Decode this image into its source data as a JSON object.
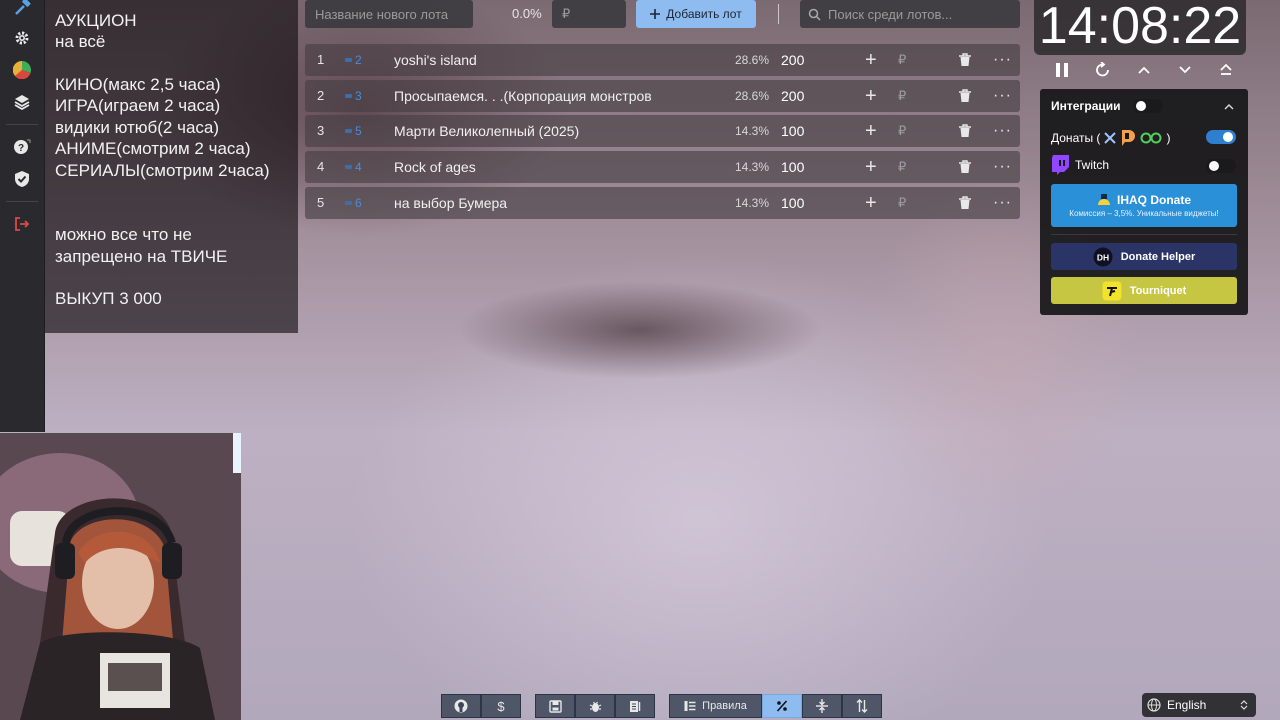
{
  "notes": {
    "lines": [
      "АУКЦИОН",
      "на всё",
      "",
      "КИНО(макс 2,5 часа)",
      "ИГРА(играем 2 часа)",
      "видики ютюб(2 часа)",
      "АНИМЕ(смотрим 2 часа)",
      "СЕРИАЛЫ(смотрим 2часа)",
      "",
      "",
      "можно все что не",
      "запрещено на ТВИЧЕ",
      "",
      "ВЫКУП 3 000"
    ]
  },
  "sidebar": {
    "items": [
      {
        "icon": "hammer-icon"
      },
      {
        "icon": "gear-icon"
      },
      {
        "icon": "pie-chart-icon"
      },
      {
        "icon": "layers-icon"
      },
      {
        "icon": "help-icon"
      },
      {
        "icon": "shield-icon"
      },
      {
        "icon": "logout-icon"
      }
    ]
  },
  "topbar": {
    "new_lot_placeholder": "Название нового лота",
    "percent": "0.0%",
    "currency": "₽",
    "add_label": "Добавить лот",
    "search_placeholder": "Поиск среди лотов..."
  },
  "lots": [
    {
      "index": "1",
      "order": "2",
      "name": "yoshi's island",
      "percent": "28.6%",
      "amount": "200",
      "currency": "₽"
    },
    {
      "index": "2",
      "order": "3",
      "name": "Просыпаемся. . .(Корпорация монстров",
      "percent": "28.6%",
      "amount": "200",
      "currency": "₽"
    },
    {
      "index": "3",
      "order": "5",
      "name": "Марти Великолепный (2025)",
      "percent": "14.3%",
      "amount": "100",
      "currency": "₽"
    },
    {
      "index": "4",
      "order": "4",
      "name": "Rock of ages",
      "percent": "14.3%",
      "amount": "100",
      "currency": "₽"
    },
    {
      "index": "5",
      "order": "6",
      "name": "на выбор Бумера",
      "percent": "14.3%",
      "amount": "100",
      "currency": "₽"
    }
  ],
  "timer": {
    "time": "14:08:22"
  },
  "integrations": {
    "title": "Интеграции",
    "donations_label": "Донаты (",
    "donations_close": ")",
    "twitch_label": "Twitch",
    "ihaq_title": "IHAQ Donate",
    "ihaq_sub": "Комиссия – 3,5%. Уникальные виджеты!",
    "donate_helper": "Donate Helper",
    "tourniquet": "Tourniquet",
    "colors": {
      "ihaq": "#2a90d8",
      "helper": "#2b3467",
      "tourniquet": "#c7c643"
    }
  },
  "bottom": {
    "rules": "Правила"
  },
  "language": {
    "selected": "English"
  }
}
